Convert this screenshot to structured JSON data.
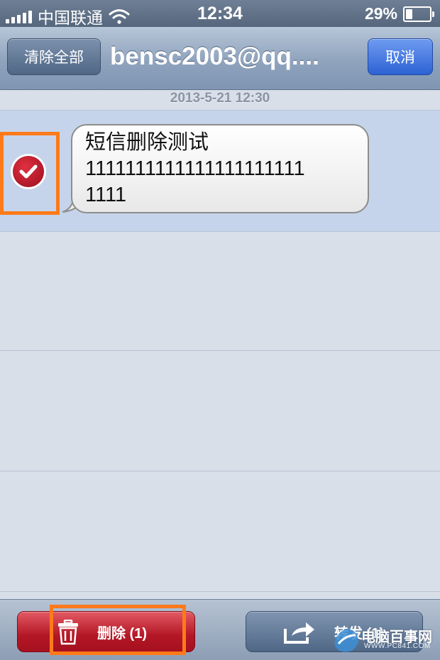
{
  "status_bar": {
    "carrier": "中国联通",
    "time": "12:34",
    "battery": "29%",
    "battery_level": 0.29
  },
  "nav": {
    "clear_all_label": "清除全部",
    "title": "bensc2003@qq....",
    "cancel_label": "取消"
  },
  "thread": {
    "date": "2013-5-21 12:30",
    "messages": [
      {
        "line1": "短信删除测试",
        "line2": "1111111111111111111111",
        "line3": "1111",
        "selected": true
      }
    ]
  },
  "toolbar": {
    "delete_label": "删除 (1)",
    "forward_label": "转发 (1)"
  },
  "watermark": {
    "text": "电脑百事网",
    "sub": "WWW.PC841.COM"
  },
  "colors": {
    "highlight": "#ff7a1a",
    "delete": "#b41726",
    "accent_blue": "#2d62d4"
  }
}
